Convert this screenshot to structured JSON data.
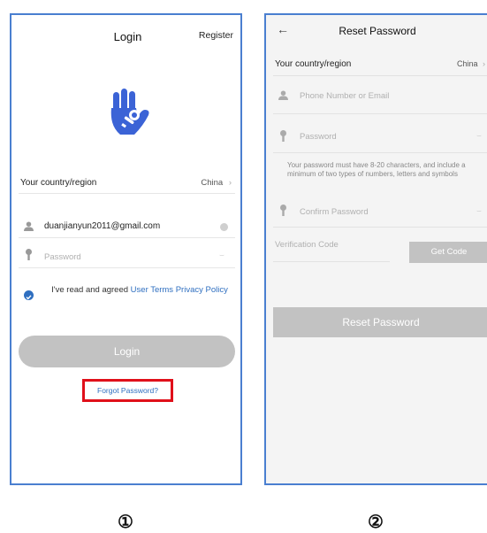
{
  "screen1": {
    "title": "Login",
    "register": "Register",
    "country_label": "Your country/region",
    "country_value": "China",
    "email_value": "duanjianyun2011@gmail.com",
    "password_placeholder": "Password",
    "agree_text": "I've read and agreed",
    "terms_link": "User Terms",
    "privacy_link": "Privacy Policy",
    "login_button": "Login",
    "forgot_link": "Forgot Password?",
    "step_number": "①"
  },
  "screen2": {
    "title": "Reset Password",
    "country_label": "Your country/region",
    "country_value": "China",
    "phone_placeholder": "Phone Number or Email",
    "password_placeholder": "Password",
    "password_hint": "Your password must have 8-20 characters, and include a minimum of two types of numbers, letters and symbols",
    "confirm_placeholder": "Confirm Password",
    "verification_placeholder": "Verification Code",
    "get_code_button": "Get Code",
    "reset_button": "Reset Password",
    "step_number": "②"
  },
  "colors": {
    "frame": "#4a7fd0",
    "accent": "#2f6fc0",
    "highlight": "#e0101a",
    "disabled_button": "#c2c2c2"
  }
}
